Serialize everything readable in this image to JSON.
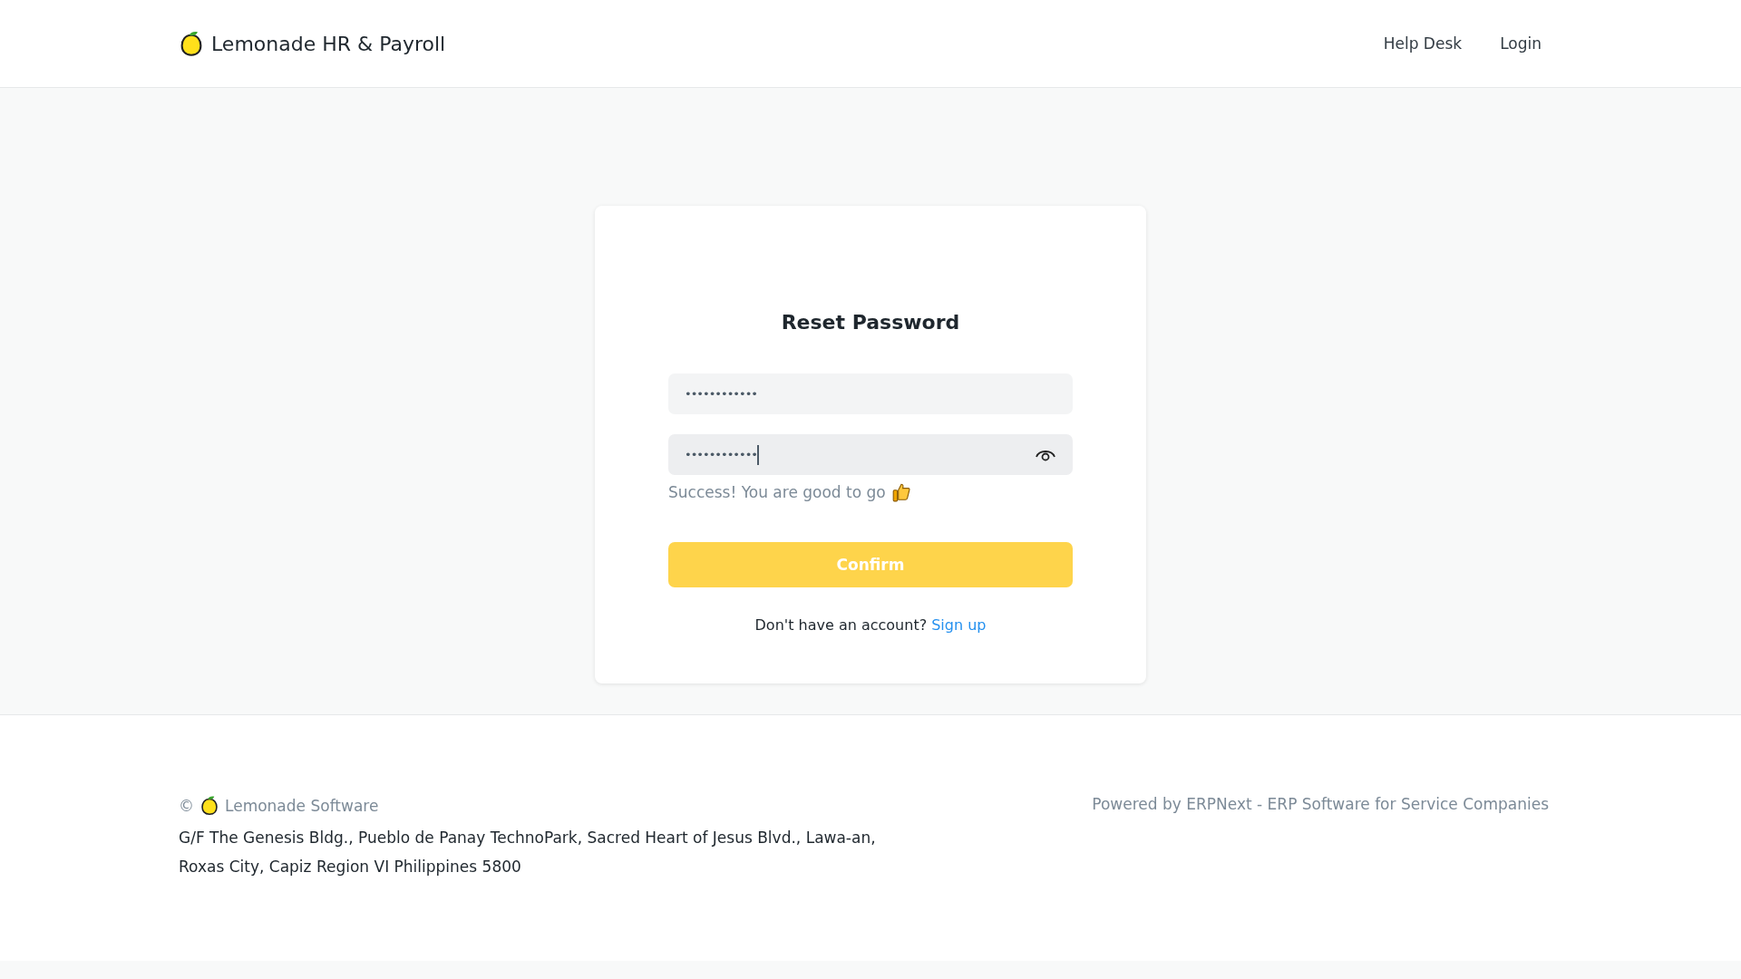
{
  "header": {
    "brand": "Lemonade HR & Payroll",
    "nav": [
      "Help Desk",
      "Login"
    ]
  },
  "card": {
    "title": "Reset Password",
    "fields": [
      {
        "value": "••••••••••••",
        "focused": false,
        "reveal_toggle": false
      },
      {
        "value": "••••••••••••",
        "focused": true,
        "reveal_toggle": true
      }
    ],
    "message": "Success! You are good to go",
    "button": "Confirm",
    "prompt": "Don't have an account?",
    "link": "Sign up"
  },
  "footer": {
    "copyright": "©",
    "company": "Lemonade Software",
    "address": "G/F The Genesis Bldg., Pueblo de Panay TechnoPark, Sacred Heart of Jesus Blvd., Lawa-an, Roxas City, Capiz Region VI Philippines 5800",
    "powered": "Powered by ERPNext - ERP Software for Service Companies"
  }
}
